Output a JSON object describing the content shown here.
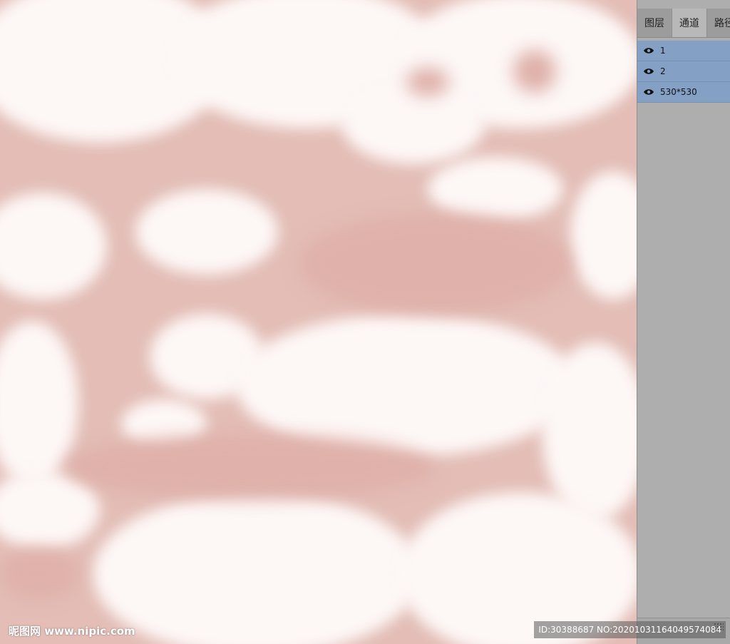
{
  "panel": {
    "tabs": [
      {
        "label": "图层",
        "active": false
      },
      {
        "label": "通道",
        "active": true
      },
      {
        "label": "路径",
        "active": false
      }
    ],
    "channels": [
      {
        "name": "1",
        "visible": true,
        "icon": "eye-icon"
      },
      {
        "name": "2",
        "visible": true,
        "icon": "eye-icon"
      },
      {
        "name": "530*530",
        "visible": true,
        "icon": "eye-icon"
      }
    ]
  },
  "watermark": {
    "site": "昵图网 www.nipic.com",
    "id_text": "ID:30388687 NO:20201031164049574084"
  },
  "colors": {
    "pink": "#e3bdb6",
    "cloud_white": "#fdf7f6",
    "panel_bg": "#aeaeae",
    "selected_row": "#84a1c5"
  }
}
